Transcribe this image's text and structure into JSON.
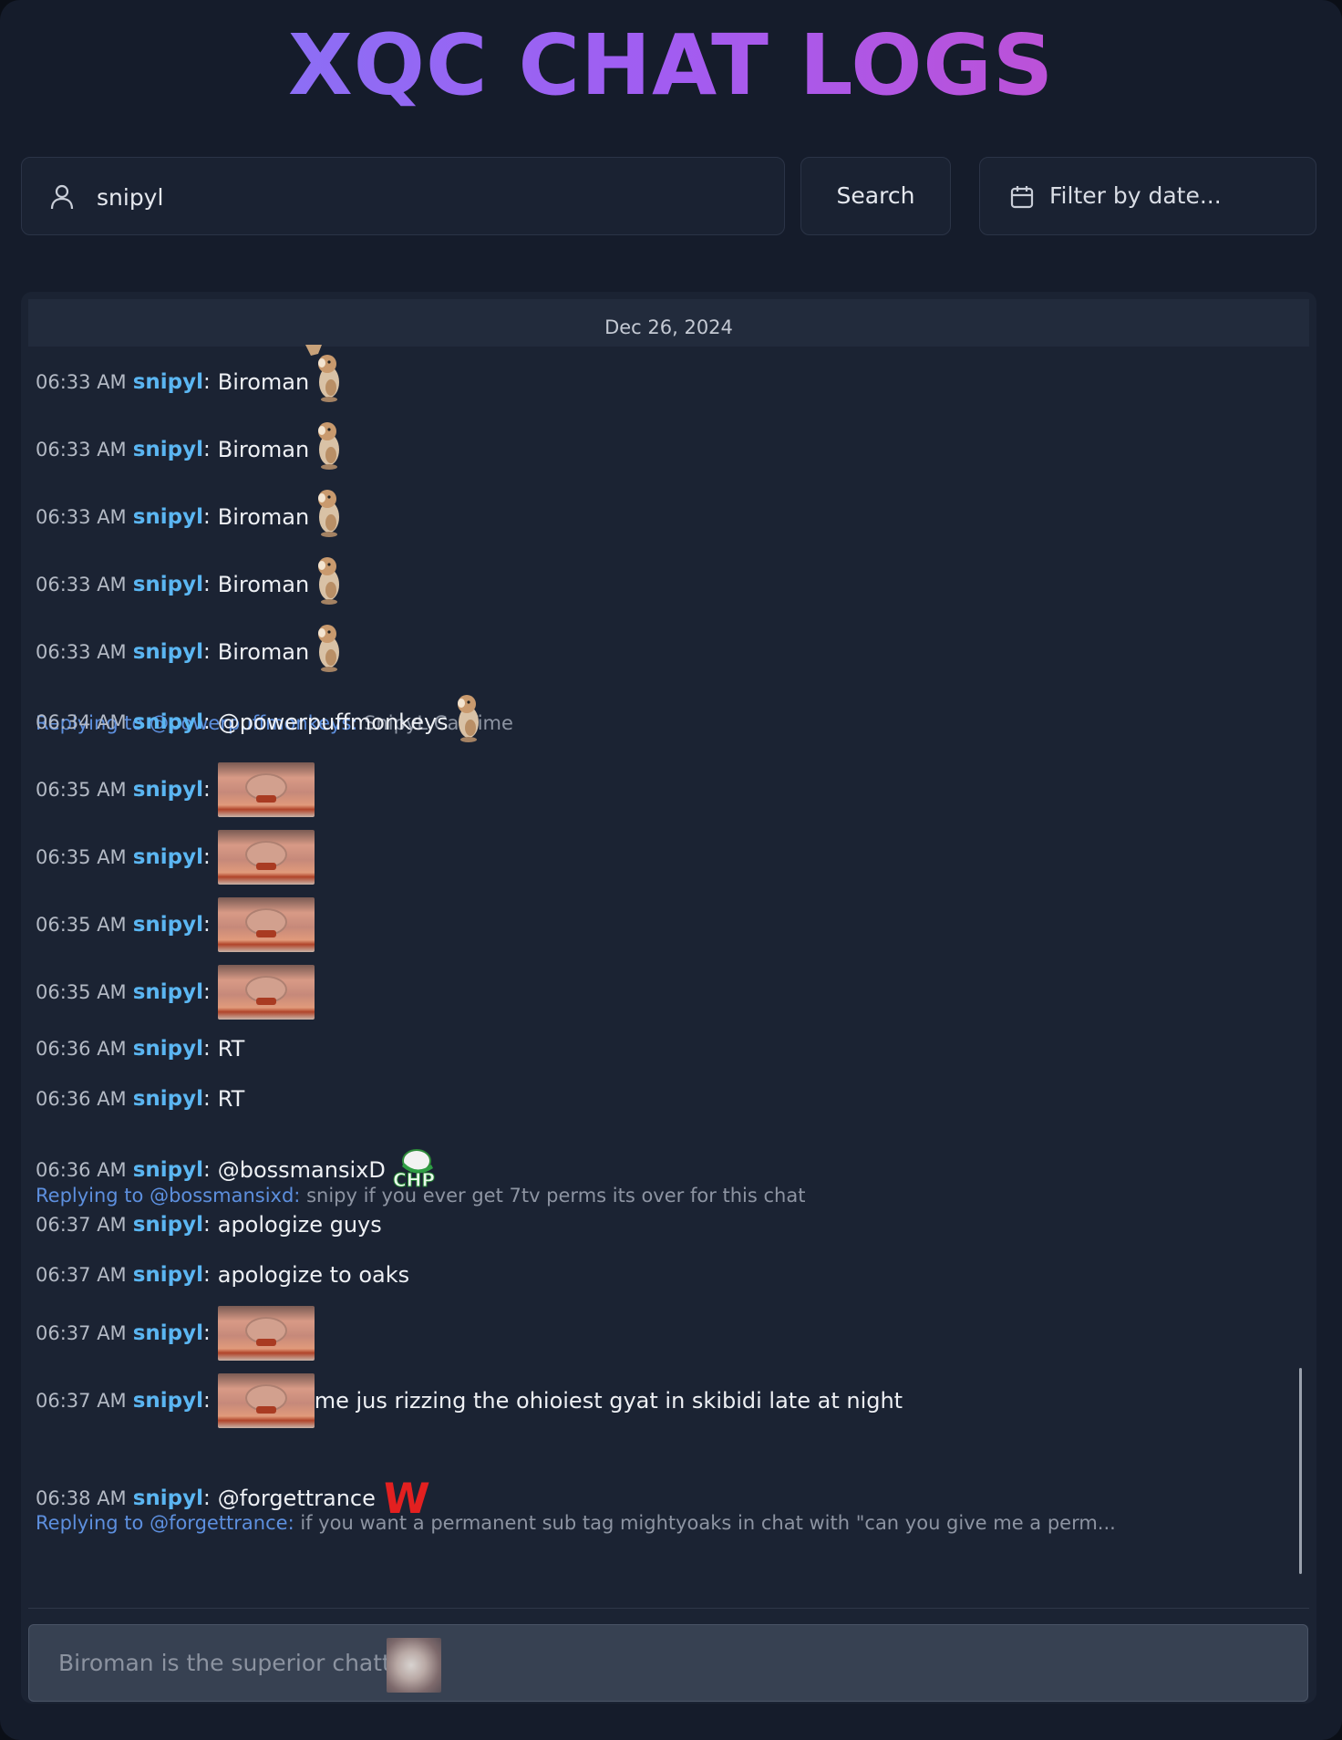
{
  "app": {
    "title": "XQC CHAT LOGS"
  },
  "search": {
    "value": "snipyl",
    "button_label": "Search",
    "user_icon": "user-icon"
  },
  "date_filter": {
    "placeholder": "Filter by date...",
    "icon": "calendar-icon"
  },
  "log": {
    "date": "Dec 26, 2024",
    "messages": [
      {
        "time": "06:33 AM",
        "user": "snipyl",
        "text": "Biroman",
        "emote": "hamster"
      },
      {
        "time": "06:33 AM",
        "user": "snipyl",
        "text": "Biroman",
        "emote": "hamster"
      },
      {
        "time": "06:33 AM",
        "user": "snipyl",
        "text": "Biroman",
        "emote": "hamster"
      },
      {
        "time": "06:33 AM",
        "user": "snipyl",
        "text": "Biroman",
        "emote": "hamster"
      },
      {
        "time": "06:33 AM",
        "user": "snipyl",
        "text": "Biroman",
        "emote": "hamster"
      },
      {
        "reply_label": "Replying to @powerpuffmonkeys:",
        "reply_text": "SnipyL CatTime",
        "time": "06:34 AM",
        "user": "snipyl",
        "text": "@powerpuffmonkeys",
        "emote": "hamster"
      },
      {
        "time": "06:35 AM",
        "user": "snipyl",
        "text": "",
        "emote": "cat"
      },
      {
        "time": "06:35 AM",
        "user": "snipyl",
        "text": "",
        "emote": "cat"
      },
      {
        "time": "06:35 AM",
        "user": "snipyl",
        "text": "",
        "emote": "cat"
      },
      {
        "time": "06:35 AM",
        "user": "snipyl",
        "text": "",
        "emote": "cat"
      },
      {
        "time": "06:36 AM",
        "user": "snipyl",
        "text": "RT"
      },
      {
        "time": "06:36 AM",
        "user": "snipyl",
        "text": "RT"
      },
      {
        "reply_label": "Replying to @bossmansixd:",
        "reply_text": "snipy if you ever get 7tv perms its over for this chat",
        "time": "06:36 AM",
        "user": "snipyl",
        "text": "@bossmansixD",
        "emote": "chp-cap"
      },
      {
        "time": "06:37 AM",
        "user": "snipyl",
        "text": "apologize guys"
      },
      {
        "time": "06:37 AM",
        "user": "snipyl",
        "text": "apologize to oaks"
      },
      {
        "time": "06:37 AM",
        "user": "snipyl",
        "text": "",
        "emote": "cat"
      },
      {
        "time": "06:37 AM",
        "user": "snipyl",
        "text": "me jus rizzing the ohioiest gyat in skibidi late at night",
        "emote": "cat",
        "emote_first": true
      },
      {
        "reply_label": "Replying to @forgettrance:",
        "reply_text": "if you want a permanent sub tag mightyoaks in chat with \"can you give me a perm...",
        "time": "06:38 AM",
        "user": "snipyl",
        "text": "@forgettrance",
        "emote": "W"
      }
    ]
  },
  "footer": {
    "text": "Biroman is the superior chatter",
    "emote": "cat-face"
  },
  "colors": {
    "username": "#5bb6f2",
    "reply_label": "#5d8fde",
    "title_gradient_start": "#7c7cf8",
    "title_gradient_end": "#d049c4",
    "w_emote": "#e32020"
  }
}
